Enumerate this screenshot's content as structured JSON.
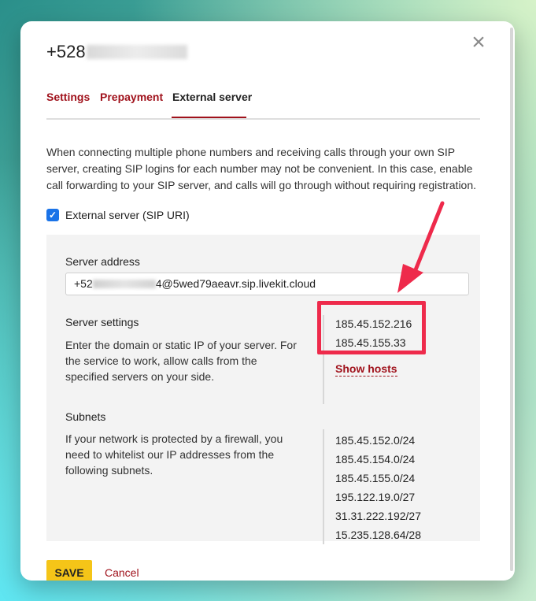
{
  "dialog": {
    "title_prefix": "+528",
    "close_glyph": "×"
  },
  "tabs": [
    {
      "label": "Settings"
    },
    {
      "label": "Prepayment"
    },
    {
      "label": "External server"
    }
  ],
  "description": "When connecting multiple phone numbers and receiving calls through your own SIP server, creating SIP logins for each number may not be convenient. In this case, enable call forwarding to your SIP server, and calls will go through without requiring registration.",
  "external_server": {
    "checkbox_label": "External server (SIP URI)",
    "checked": true
  },
  "server_address": {
    "label": "Server address",
    "value_prefix": "+52",
    "value_suffix": "4@5wed79aeavr.sip.livekit.cloud"
  },
  "server_settings": {
    "label": "Server settings",
    "help": "Enter the domain or static IP of your server. For the service to work, allow calls from the specified servers on your side.",
    "ips": [
      "185.45.152.216",
      "185.45.155.33"
    ],
    "show_hosts": "Show hosts"
  },
  "subnets": {
    "label": "Subnets",
    "help": "If your network is protected by a firewall, you need to whitelist our IP addresses from the following subnets.",
    "items": [
      "185.45.152.0/24",
      "185.45.154.0/24",
      "185.45.155.0/24",
      "195.122.19.0/27",
      "31.31.222.192/27",
      "15.235.128.64/28"
    ]
  },
  "actions": {
    "save": "SAVE",
    "cancel": "Cancel"
  },
  "colors": {
    "accent_red": "#a0121c",
    "checkbox_blue": "#1a73e8",
    "save_yellow": "#f5c518",
    "annotation_red": "#ee2a4b"
  }
}
